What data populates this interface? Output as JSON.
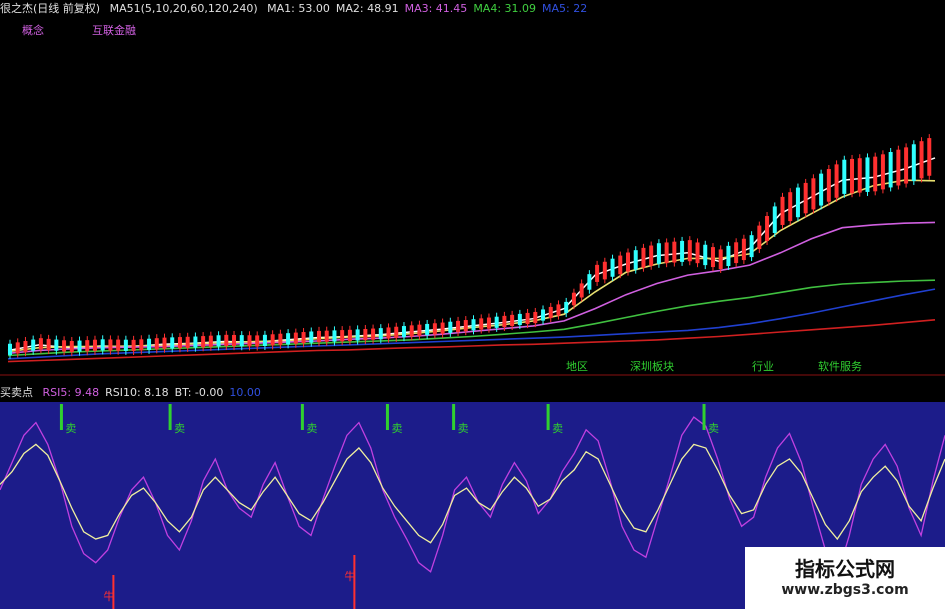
{
  "header": {
    "indicator_name": "很之杰(日线 前复权)",
    "ma_params": "MA51(5,10,20,60,120,240)",
    "ma_values": [
      {
        "label": "MA1: 53.00",
        "color": "#e0e0e0"
      },
      {
        "label": "MA2: 48.91",
        "color": "#e0e0e0"
      },
      {
        "label": "MA3: 41.45",
        "color": "#d060e0"
      },
      {
        "label": "MA4: 31.09",
        "color": "#40d040"
      },
      {
        "label": "MA5: 22",
        "color": "#3050e0"
      }
    ],
    "concept_label": "概念",
    "concept_value": "互联金融"
  },
  "tags": [
    {
      "text": "地区",
      "color": "#30d030"
    },
    {
      "text": "深圳板块",
      "color": "#30d030"
    },
    {
      "text": "行业",
      "color": "#30d030"
    },
    {
      "text": "软件服务",
      "color": "#30d030"
    }
  ],
  "lower_header": {
    "title": "买卖点",
    "items": [
      {
        "label": "RSI5: 9.48",
        "color": "#d060e0"
      },
      {
        "label": "RSI10: 8.18",
        "color": "#e0e0e0"
      },
      {
        "label": "BT: -0.00",
        "color": "#e0e0e0"
      },
      {
        "label": "10.00",
        "color": "#3050e0"
      }
    ]
  },
  "markers": {
    "sell_text": "卖",
    "buy_text": "牛",
    "sell_positions": [
      0.065,
      0.18,
      0.32,
      0.41,
      0.48,
      0.58,
      0.745
    ],
    "buy_labels": [
      {
        "text": "牛",
        "pos": 0.12
      },
      {
        "text": "牛",
        "pos": 0.375
      }
    ]
  },
  "colors": {
    "upper_bg": "#000000",
    "lower_bg": "#1c1c8a",
    "ma1": "#ffffff",
    "ma2": "#e8e070",
    "ma3": "#d060e0",
    "ma4": "#40c040",
    "ma5": "#2040d0",
    "ma6": "#d02020",
    "rsi_fast": "#c040e0",
    "rsi_slow": "#f0f0a0",
    "up_candle": "#ff3030",
    "down_candle": "#30ffff",
    "sell_marker": "#30d030",
    "buy_marker": "#ff3030"
  },
  "chart_data": [
    {
      "type": "line",
      "x": [
        0,
        1,
        2,
        3,
        4,
        5,
        6,
        7,
        8,
        9,
        10,
        11,
        12,
        13,
        14,
        15,
        16,
        17,
        18,
        19,
        20,
        21,
        22,
        23,
        24,
        25,
        26,
        27,
        28,
        29,
        30
      ],
      "series": [
        {
          "values": [
            18.5,
            19.5,
            19.0,
            19.3,
            19.2,
            19.6,
            19.8,
            20.1,
            20.0,
            20.4,
            20.8,
            21.0,
            21.3,
            21.8,
            22.3,
            22.9,
            23.5,
            24.2,
            26.0,
            32.0,
            34.0,
            35.5,
            36.0,
            34.5,
            36.8,
            43.0,
            46.0,
            49.0,
            49.5,
            51.0,
            53.0
          ]
        },
        {
          "values": [
            18.3,
            19.0,
            19.2,
            19.2,
            19.3,
            19.4,
            19.7,
            19.9,
            20.1,
            20.2,
            20.6,
            20.9,
            21.1,
            21.5,
            22.0,
            22.6,
            23.1,
            23.8,
            25.0,
            29.0,
            32.5,
            34.0,
            35.0,
            35.0,
            35.8,
            40.0,
            43.0,
            46.0,
            48.0,
            49.0,
            48.9
          ]
        },
        {
          "values": [
            18.0,
            18.5,
            18.8,
            19.0,
            19.1,
            19.2,
            19.4,
            19.6,
            19.8,
            20.0,
            20.2,
            20.5,
            20.7,
            21.0,
            21.4,
            21.9,
            22.4,
            22.9,
            23.8,
            26.0,
            28.5,
            30.5,
            32.0,
            32.8,
            33.8,
            36.0,
            38.5,
            40.5,
            41.0,
            41.3,
            41.45
          ]
        },
        {
          "values": [
            17.6,
            17.9,
            18.2,
            18.4,
            18.6,
            18.8,
            19.0,
            19.2,
            19.4,
            19.6,
            19.8,
            20.0,
            20.2,
            20.4,
            20.7,
            21.0,
            21.4,
            21.8,
            22.3,
            23.3,
            24.4,
            25.5,
            26.5,
            27.3,
            28.0,
            28.9,
            29.8,
            30.4,
            30.7,
            30.95,
            31.09
          ]
        },
        {
          "values": [
            17.0,
            17.3,
            17.6,
            17.9,
            18.1,
            18.3,
            18.5,
            18.7,
            18.9,
            19.1,
            19.3,
            19.5,
            19.7,
            19.9,
            20.1,
            20.3,
            20.5,
            20.7,
            20.9,
            21.2,
            21.5,
            21.8,
            22.1,
            22.6,
            23.3,
            24.2,
            25.2,
            26.3,
            27.4,
            28.5,
            29.5
          ]
        },
        {
          "values": [
            16.5,
            16.7,
            16.9,
            17.1,
            17.3,
            17.5,
            17.7,
            17.9,
            18.1,
            18.3,
            18.5,
            18.6,
            18.8,
            19.0,
            19.1,
            19.3,
            19.5,
            19.6,
            19.8,
            20.0,
            20.2,
            20.4,
            20.7,
            21.0,
            21.4,
            21.8,
            22.2,
            22.6,
            23.0,
            23.5,
            24.0
          ]
        }
      ],
      "ylim": [
        15,
        58
      ]
    },
    {
      "type": "line",
      "x": [
        0,
        1,
        2,
        3,
        4,
        5,
        6,
        7,
        8,
        9,
        10,
        11,
        12,
        13,
        14,
        15,
        16,
        17,
        18,
        19,
        20,
        21,
        22,
        23,
        24,
        25,
        26,
        27,
        28,
        29,
        30,
        31,
        32,
        33,
        34,
        35,
        36,
        37,
        38,
        39,
        40,
        41,
        42,
        43,
        44,
        45,
        46,
        47,
        48,
        49,
        50,
        51,
        52,
        53,
        54,
        55,
        56,
        57,
        58,
        59,
        60,
        61,
        62,
        63,
        64,
        65,
        66,
        67,
        68,
        69,
        70,
        71,
        72,
        73,
        74,
        75,
        76,
        77,
        78,
        79
      ],
      "series": [
        {
          "values": [
            55,
            70,
            85,
            92,
            80,
            60,
            35,
            20,
            15,
            22,
            40,
            55,
            62,
            48,
            30,
            22,
            38,
            60,
            72,
            55,
            45,
            40,
            58,
            70,
            52,
            35,
            30,
            50,
            68,
            85,
            92,
            78,
            55,
            40,
            28,
            15,
            10,
            30,
            55,
            62,
            48,
            40,
            58,
            70,
            60,
            42,
            50,
            65,
            75,
            88,
            82,
            60,
            35,
            22,
            18,
            40,
            62,
            85,
            95,
            90,
            72,
            50,
            35,
            40,
            62,
            78,
            86,
            70,
            45,
            22,
            8,
            30,
            58,
            72,
            80,
            68,
            45,
            30,
            60,
            85
          ]
        },
        {
          "values": [
            58,
            65,
            75,
            80,
            74,
            60,
            45,
            32,
            28,
            30,
            42,
            52,
            56,
            48,
            38,
            32,
            40,
            55,
            62,
            55,
            48,
            44,
            54,
            62,
            52,
            42,
            38,
            48,
            60,
            72,
            78,
            70,
            56,
            46,
            38,
            30,
            26,
            36,
            52,
            56,
            48,
            44,
            54,
            62,
            56,
            46,
            50,
            60,
            66,
            76,
            72,
            58,
            44,
            34,
            32,
            44,
            58,
            72,
            80,
            78,
            66,
            52,
            42,
            44,
            58,
            68,
            72,
            64,
            50,
            36,
            28,
            38,
            54,
            62,
            68,
            60,
            46,
            38,
            56,
            72
          ]
        }
      ],
      "ylim": [
        0,
        100
      ]
    }
  ]
}
